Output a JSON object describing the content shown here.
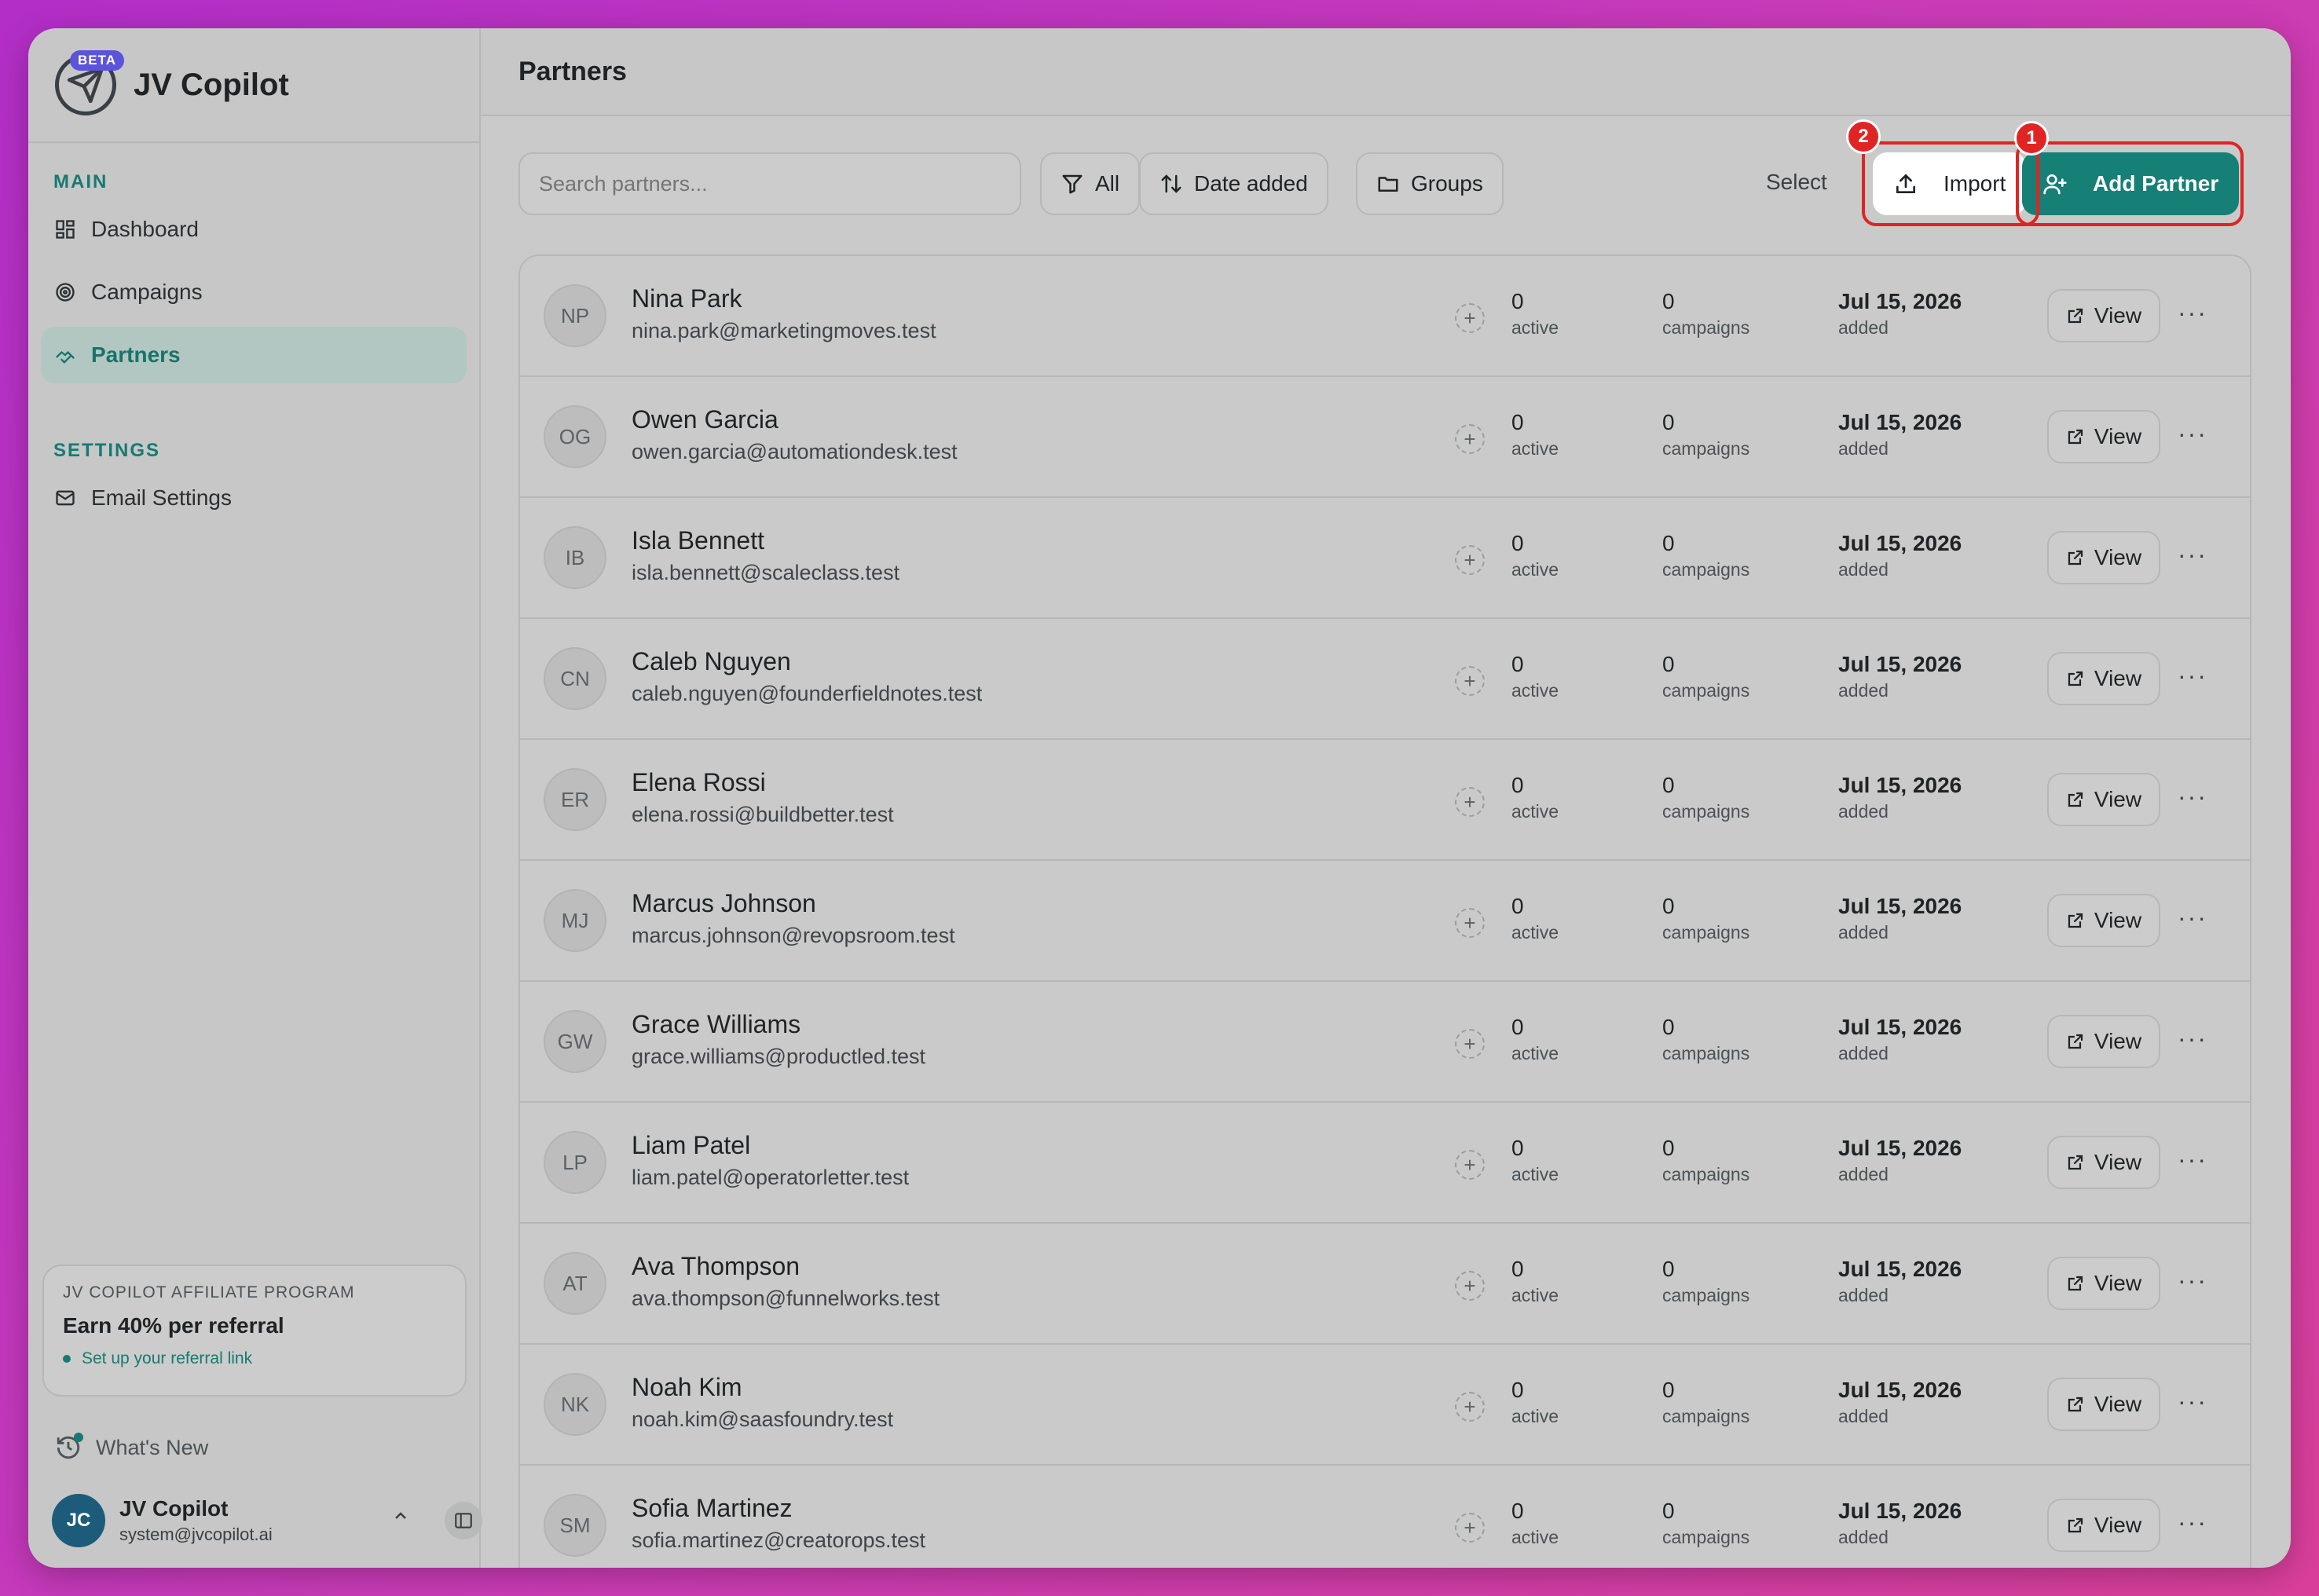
{
  "app": {
    "name": "JV Copilot",
    "beta": "BETA"
  },
  "nav": {
    "main_label": "MAIN",
    "items": [
      {
        "label": "Dashboard"
      },
      {
        "label": "Campaigns"
      },
      {
        "label": "Partners"
      }
    ],
    "settings_label": "SETTINGS",
    "settings_items": [
      {
        "label": "Email Settings"
      }
    ]
  },
  "affiliate": {
    "heading": "JV COPILOT AFFILIATE PROGRAM",
    "title": "Earn 40% per referral",
    "link": "Set up your referral link"
  },
  "whats_new": "What's New",
  "user": {
    "initials": "JC",
    "name": "JV Copilot",
    "email": "system@jvcopilot.ai"
  },
  "page": {
    "title": "Partners"
  },
  "toolbar": {
    "search_placeholder": "Search partners...",
    "filter_label": "All",
    "sort_label": "Date added",
    "groups_label": "Groups",
    "select_label": "Select",
    "import_label": "Import",
    "add_label": "Add Partner",
    "badge_import": "2",
    "badge_add": "1"
  },
  "labels": {
    "active": "active",
    "campaigns": "campaigns",
    "added": "added",
    "view": "View"
  },
  "partners": [
    {
      "initials": "NP",
      "name": "Nina Park",
      "email": "nina.park@marketingmoves.test",
      "active": "0",
      "campaigns": "0",
      "date": "Jul 15, 2026"
    },
    {
      "initials": "OG",
      "name": "Owen Garcia",
      "email": "owen.garcia@automationdesk.test",
      "active": "0",
      "campaigns": "0",
      "date": "Jul 15, 2026"
    },
    {
      "initials": "IB",
      "name": "Isla Bennett",
      "email": "isla.bennett@scaleclass.test",
      "active": "0",
      "campaigns": "0",
      "date": "Jul 15, 2026"
    },
    {
      "initials": "CN",
      "name": "Caleb Nguyen",
      "email": "caleb.nguyen@founderfieldnotes.test",
      "active": "0",
      "campaigns": "0",
      "date": "Jul 15, 2026"
    },
    {
      "initials": "ER",
      "name": "Elena Rossi",
      "email": "elena.rossi@buildbetter.test",
      "active": "0",
      "campaigns": "0",
      "date": "Jul 15, 2026"
    },
    {
      "initials": "MJ",
      "name": "Marcus Johnson",
      "email": "marcus.johnson@revopsroom.test",
      "active": "0",
      "campaigns": "0",
      "date": "Jul 15, 2026"
    },
    {
      "initials": "GW",
      "name": "Grace Williams",
      "email": "grace.williams@productled.test",
      "active": "0",
      "campaigns": "0",
      "date": "Jul 15, 2026"
    },
    {
      "initials": "LP",
      "name": "Liam Patel",
      "email": "liam.patel@operatorletter.test",
      "active": "0",
      "campaigns": "0",
      "date": "Jul 15, 2026"
    },
    {
      "initials": "AT",
      "name": "Ava Thompson",
      "email": "ava.thompson@funnelworks.test",
      "active": "0",
      "campaigns": "0",
      "date": "Jul 15, 2026"
    },
    {
      "initials": "NK",
      "name": "Noah Kim",
      "email": "noah.kim@saasfoundry.test",
      "active": "0",
      "campaigns": "0",
      "date": "Jul 15, 2026"
    },
    {
      "initials": "SM",
      "name": "Sofia Martinez",
      "email": "sofia.martinez@creatorops.test",
      "active": "0",
      "campaigns": "0",
      "date": "Jul 15, 2026"
    }
  ]
}
